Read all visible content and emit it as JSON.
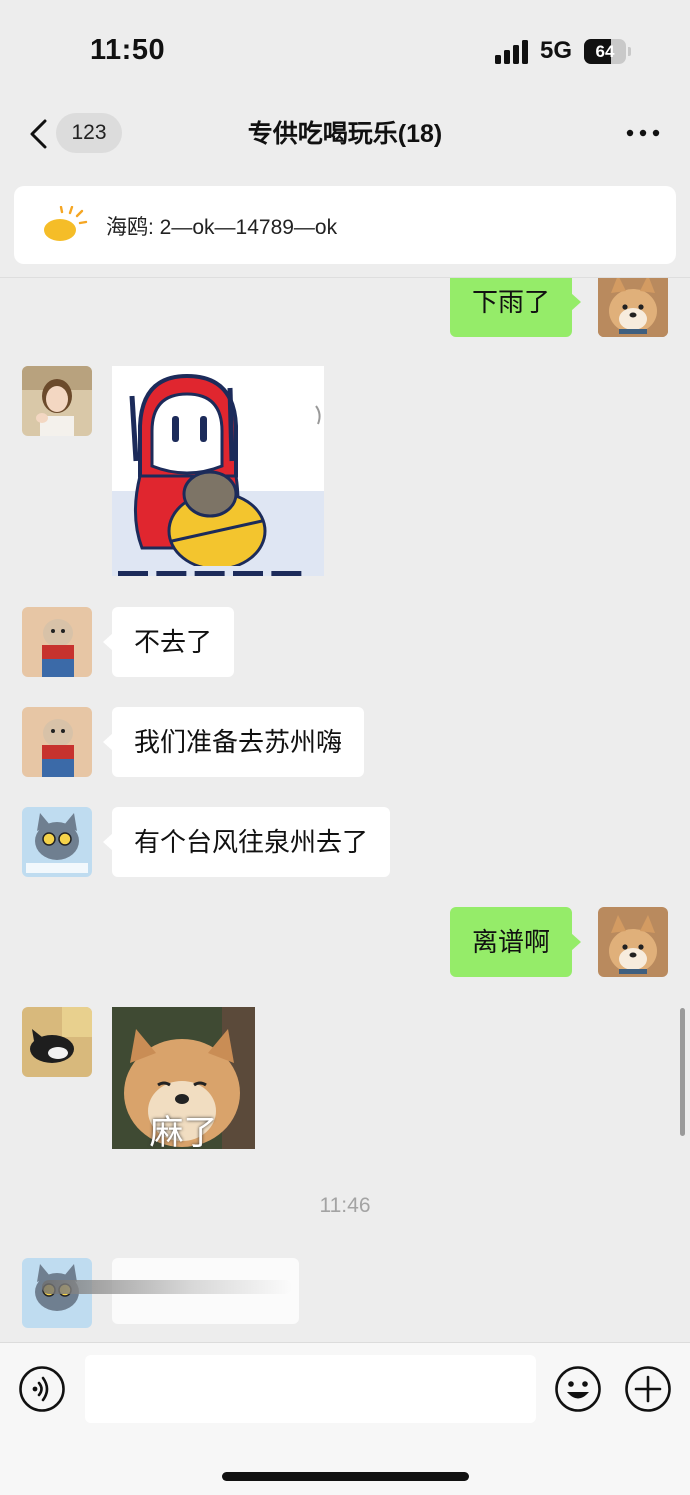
{
  "status_bar": {
    "time": "11:50",
    "network": "5G",
    "battery": "64",
    "battery_level_percent": 64
  },
  "nav": {
    "unread_count": "123",
    "title": "专供吃喝玩乐(18)"
  },
  "pinned": {
    "icon": "sun-icon",
    "text": "海鸥: 2—ok—14789—ok"
  },
  "messages": [
    {
      "side": "right",
      "type": "text",
      "text": "下雨了",
      "avatar": "shiba-avatar"
    },
    {
      "side": "left",
      "type": "sticker",
      "avatar": "girl-avatar",
      "sticker": "red-hood-cartoon-sticker"
    },
    {
      "side": "left",
      "type": "text",
      "text": "不去了",
      "avatar": "dressed-cat-avatar"
    },
    {
      "side": "left",
      "type": "text",
      "text": "我们准备去苏州嗨",
      "avatar": "dressed-cat-avatar"
    },
    {
      "side": "left",
      "type": "text",
      "text": "有个台风往泉州去了",
      "avatar": "gray-cat-avatar"
    },
    {
      "side": "right",
      "type": "text",
      "text": "离谱啊",
      "avatar": "shiba-avatar"
    },
    {
      "side": "left",
      "type": "sticker",
      "avatar": "tuxedo-cat-avatar",
      "sticker": "dog-sticker",
      "caption": "麻了"
    },
    {
      "side": "left",
      "type": "blurred",
      "avatar": "gray-cat-avatar"
    }
  ],
  "timestamp": "11:46",
  "input_bar": {
    "placeholder": "",
    "icons": [
      "voice-icon",
      "emoji-icon",
      "plus-icon"
    ]
  },
  "colors": {
    "background": "#ededed",
    "bubble_self": "#95ec69",
    "bubble_other": "#ffffff",
    "timestamp_text": "#a3a3a3"
  }
}
